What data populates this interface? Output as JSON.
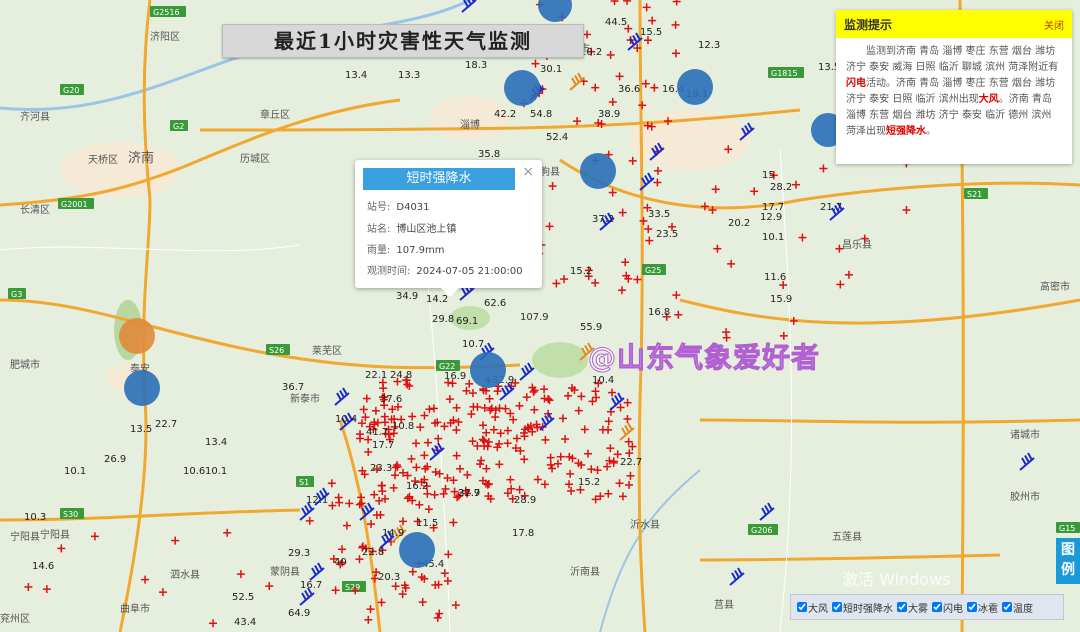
{
  "title": "最近1小时灾害性天气监测",
  "popup": {
    "header": "短时强降水",
    "close": "×",
    "station_id_label": "站号:",
    "station_id": "D4031",
    "station_name_label": "站名:",
    "station_name": "博山区池上镇",
    "rain_label": "雨量:",
    "rain": "107.9mm",
    "time_label": "观测时间:",
    "time": "2024-07-05 21:00:00"
  },
  "notice": {
    "title": "监测提示",
    "close": "关闭",
    "p1": "监测到济南 青岛 淄博 枣庄 东营 烟台 潍坊 济宁 泰安 威海 日照 临沂 聊城 滨州 菏泽附近有",
    "h1": "闪电",
    "p2": "活动。济南 青岛 淄博 枣庄 东营 烟台 潍坊 济宁 泰安 日照 临沂 滨州出现",
    "h2": "大风",
    "p3": "。济南 青岛 淄博 东营 烟台 潍坊 济宁 泰安 临沂 德州 滨州 菏泽出现",
    "h3": "短强降水",
    "p4": "。"
  },
  "legend_tab": "图例",
  "legend": [
    "大风",
    "短时强降水",
    "大雾",
    "闪电",
    "冰雹",
    "温度"
  ],
  "watermark": "@山东气象爱好者",
  "os_watermark": "激活 Windows",
  "places": [
    "济南",
    "济阳区",
    "齐河县",
    "长清区",
    "天桥区",
    "历城区",
    "章丘区",
    "淄博",
    "泰安",
    "肥城市",
    "莱芜区",
    "新泰市",
    "蒙阴县",
    "沂水县",
    "沂南县",
    "莒县",
    "五莲县",
    "高密市",
    "诸城市",
    "昌乐县",
    "青州市",
    "临朐县",
    "安丘市",
    "宁阳县",
    "泗水县",
    "曲阜市",
    "兖州区",
    "宁阳县",
    "胶州市"
  ],
  "roads": [
    "G2516",
    "G20",
    "G2",
    "G2001",
    "G3",
    "S26",
    "G22",
    "S29",
    "S1",
    "S30",
    "G1815",
    "G25",
    "S21",
    "G15",
    "G206"
  ],
  "values": [
    "44.5",
    "15.5",
    "10.2",
    "12.3",
    "13.5",
    "16.4",
    "19.1",
    "13.4",
    "13.3",
    "18.3",
    "42.2",
    "54.8",
    "38.9",
    "36.6",
    "52.4",
    "35.8",
    "28.2",
    "21.7",
    "22.7",
    "30.1",
    "33.5",
    "37.2",
    "20.2",
    "23.5",
    "15.2",
    "16.8",
    "34.9",
    "14.2",
    "29.8",
    "69.1",
    "62.6",
    "107.9",
    "55.9",
    "10.7",
    "16.9",
    "32.9",
    "22.1",
    "24.8",
    "36.7",
    "37.6",
    "10.4",
    "41.7",
    "10.8",
    "17.7",
    "23.3",
    "16.2",
    "37.9",
    "26.9",
    "22.7",
    "13.4",
    "10.1",
    "10.6",
    "10.1",
    "10.3",
    "14.6",
    "12.9",
    "10.4",
    "15.2",
    "28.9",
    "17.8",
    "22.7",
    "12.1",
    "14.9",
    "11.5",
    "45.4",
    "40",
    "16.7",
    "64.9",
    "52.5",
    "43.4",
    "20.3",
    "29.3",
    "13.5",
    "15",
    "17.7",
    "10.1",
    "11.6",
    "15.9",
    "22.8",
    "38.2",
    "12.2",
    "11.6",
    "16.7"
  ]
}
